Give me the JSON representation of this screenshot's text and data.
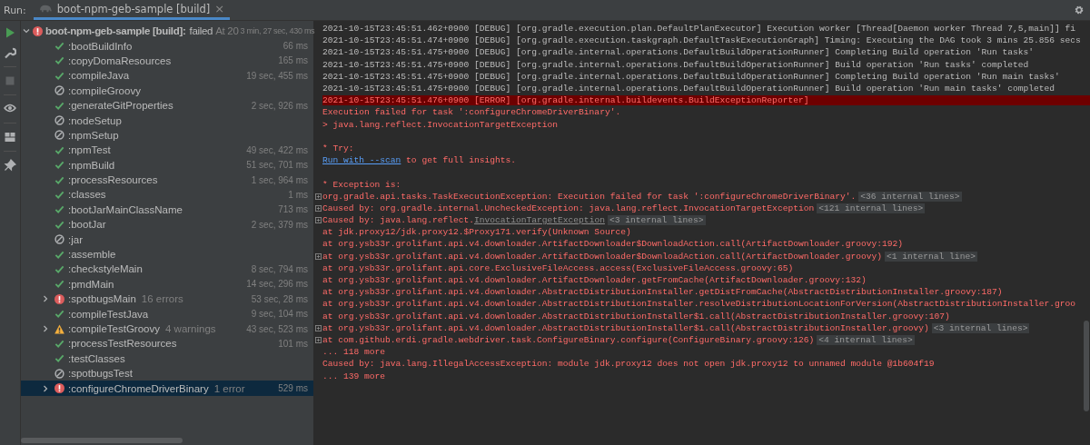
{
  "run_bar": {
    "label": "Run:",
    "tab": {
      "title": "boot-npm-geb-sample [build]",
      "close": "×",
      "selected": true
    }
  },
  "toolbar": [
    {
      "kind": "play"
    },
    {
      "kind": "wrench"
    },
    {
      "kind": "stop"
    },
    {
      "kind": "eye"
    },
    {
      "kind": "layout"
    },
    {
      "kind": "pin"
    }
  ],
  "tree": {
    "root": {
      "kind": "error",
      "name": "boot-npm-geb-sample [build]:",
      "state_text": "failed",
      "note": "At 20",
      "duration": "3 min, 27 sec, 430 ms",
      "expanded": true,
      "selected": false,
      "children": [
        {
          "kind": "success",
          "name": ":bootBuildInfo",
          "duration": "66 ms",
          "selected": false
        },
        {
          "kind": "success",
          "name": ":copyDomaResources",
          "duration": "165 ms",
          "selected": false
        },
        {
          "kind": "success",
          "name": ":compileJava",
          "duration": "19 sec, 455 ms",
          "selected": false
        },
        {
          "kind": "skipped",
          "name": ":compileGroovy",
          "selected": false
        },
        {
          "kind": "success",
          "name": ":generateGitProperties",
          "duration": "2 sec, 926 ms",
          "selected": false
        },
        {
          "kind": "skipped",
          "name": ":nodeSetup",
          "selected": false
        },
        {
          "kind": "skipped",
          "name": ":npmSetup",
          "selected": false
        },
        {
          "kind": "success",
          "name": ":npmTest",
          "duration": "49 sec, 422 ms",
          "selected": false
        },
        {
          "kind": "success",
          "name": ":npmBuild",
          "duration": "51 sec, 701 ms",
          "selected": false
        },
        {
          "kind": "success",
          "name": ":processResources",
          "duration": "1 sec, 964 ms",
          "selected": false
        },
        {
          "kind": "success",
          "name": ":classes",
          "duration": "1 ms",
          "selected": false
        },
        {
          "kind": "success",
          "name": ":bootJarMainClassName",
          "duration": "713 ms",
          "selected": false
        },
        {
          "kind": "success",
          "name": ":bootJar",
          "duration": "2 sec, 379 ms",
          "selected": false
        },
        {
          "kind": "skipped",
          "name": ":jar",
          "selected": false
        },
        {
          "kind": "success",
          "name": ":assemble",
          "selected": false
        },
        {
          "kind": "success",
          "name": ":checkstyleMain",
          "duration": "8 sec, 794 ms",
          "selected": false
        },
        {
          "kind": "success",
          "name": ":pmdMain",
          "duration": "14 sec, 296 ms",
          "selected": false
        },
        {
          "kind": "error",
          "name": ":spotbugsMain",
          "note": "16 errors",
          "duration": "53 sec, 28 ms",
          "expanded": false,
          "selected": false
        },
        {
          "kind": "success",
          "name": ":compileTestJava",
          "duration": "9 sec, 104 ms",
          "selected": false
        },
        {
          "kind": "warning",
          "name": ":compileTestGroovy",
          "note": "4 warnings",
          "duration": "43 sec, 523 ms",
          "expanded": false,
          "selected": false
        },
        {
          "kind": "success",
          "name": ":processTestResources",
          "duration": "101 ms",
          "selected": false
        },
        {
          "kind": "success",
          "name": ":testClasses",
          "selected": false
        },
        {
          "kind": "skipped",
          "name": ":spotbugsTest",
          "selected": false
        },
        {
          "kind": "error",
          "name": ":configureChromeDriverBinary",
          "note": "1 error",
          "duration": "529 ms",
          "expanded": false,
          "selected": true
        }
      ]
    }
  },
  "console": {
    "lines": [
      {
        "kind": "debug",
        "text": "2021-10-15T23:45:51.462+0900 [DEBUG] [org.gradle.execution.plan.DefaultPlanExecutor] Execution worker [Thread[Daemon worker Thread 7,5,main]] fi"
      },
      {
        "kind": "debug",
        "text": "2021-10-15T23:45:51.474+0900 [DEBUG] [org.gradle.execution.taskgraph.DefaultTaskExecutionGraph] Timing: Executing the DAG took 3 mins 25.856 secs"
      },
      {
        "kind": "debug",
        "text": "2021-10-15T23:45:51.475+0900 [DEBUG] [org.gradle.internal.operations.DefaultBuildOperationRunner] Completing Build operation 'Run tasks'"
      },
      {
        "kind": "debug",
        "text": "2021-10-15T23:45:51.475+0900 [DEBUG] [org.gradle.internal.operations.DefaultBuildOperationRunner] Build operation 'Run tasks' completed"
      },
      {
        "kind": "debug",
        "text": "2021-10-15T23:45:51.475+0900 [DEBUG] [org.gradle.internal.operations.DefaultBuildOperationRunner] Completing Build operation 'Run main tasks'"
      },
      {
        "kind": "debug",
        "text": "2021-10-15T23:45:51.475+0900 [DEBUG] [org.gradle.internal.operations.DefaultBuildOperationRunner] Build operation 'Run main tasks' completed"
      },
      {
        "kind": "error_header",
        "text": "2021-10-15T23:45:51.476+0900 [ERROR] [org.gradle.internal.buildevents.BuildExceptionReporter]"
      },
      {
        "kind": "error",
        "text": "Execution failed for task ':configureChromeDriverBinary'."
      },
      {
        "kind": "error",
        "text": "> java.lang.reflect.InvocationTargetException"
      },
      {
        "kind": "blank"
      },
      {
        "kind": "error",
        "text": "* Try:"
      },
      {
        "kind": "error",
        "link": {
          "kind": "hyperlink",
          "text": "Run with --scan"
        },
        "text_after": " to get full insights."
      },
      {
        "kind": "blank"
      },
      {
        "kind": "error",
        "text": "* Exception is:"
      },
      {
        "kind": "error",
        "collapsed": true,
        "text": "org.gradle.api.tasks.TaskExecutionException: Execution failed for task ':configureChromeDriverBinary'.",
        "internal": "<36 internal lines>"
      },
      {
        "kind": "error",
        "collapsed": true,
        "text": "Caused by: org.gradle.internal.UncheckedException: java.lang.reflect.InvocationTargetException",
        "internal": "<121 internal lines>"
      },
      {
        "kind": "error",
        "collapsed": true,
        "text": "Caused by: java.lang.reflect.",
        "link": {
          "kind": "class",
          "text": "InvocationTargetException"
        },
        "internal": "<3 internal lines>"
      },
      {
        "kind": "error",
        "text": "at jdk.proxy12/jdk.proxy12.$Proxy171.verify(Unknown Source)"
      },
      {
        "kind": "error",
        "text": "at org.ysb33r.grolifant.api.v4.downloader.ArtifactDownloader$DownloadAction.call(ArtifactDownloader.groovy:192)"
      },
      {
        "kind": "error",
        "collapsed": true,
        "text": "at org.ysb33r.grolifant.api.v4.downloader.ArtifactDownloader$DownloadAction.call(ArtifactDownloader.groovy)",
        "internal": "<1 internal line>"
      },
      {
        "kind": "error",
        "text": "at org.ysb33r.grolifant.api.core.ExclusiveFileAccess.access(ExclusiveFileAccess.groovy:65)"
      },
      {
        "kind": "error",
        "text": "at org.ysb33r.grolifant.api.v4.downloader.ArtifactDownloader.getFromCache(ArtifactDownloader.groovy:132)"
      },
      {
        "kind": "error",
        "text": "at org.ysb33r.grolifant.api.v4.downloader.AbstractDistributionInstaller.getDistFromCache(AbstractDistributionInstaller.groovy:187)"
      },
      {
        "kind": "error",
        "text": "at org.ysb33r.grolifant.api.v4.downloader.AbstractDistributionInstaller.resolveDistributionLocationForVersion(AbstractDistributionInstaller.groo"
      },
      {
        "kind": "error",
        "text": "at org.ysb33r.grolifant.api.v4.downloader.AbstractDistributionInstaller$1.call(AbstractDistributionInstaller.groovy:107)"
      },
      {
        "kind": "error",
        "collapsed": true,
        "text": "at org.ysb33r.grolifant.api.v4.downloader.AbstractDistributionInstaller$1.call(AbstractDistributionInstaller.groovy)",
        "internal": "<3 internal lines>"
      },
      {
        "kind": "error",
        "collapsed": true,
        "text": "at com.github.erdi.gradle.webdriver.task.ConfigureBinary.configure(ConfigureBinary.groovy:126)",
        "internal": "<4 internal lines>"
      },
      {
        "kind": "error",
        "text": "... 118 more"
      },
      {
        "kind": "error",
        "text": "Caused by: java.lang.IllegalAccessException: module jdk.proxy12 does not open jdk.proxy12 to unnamed module @1b604f19"
      },
      {
        "kind": "error",
        "text": "... 139 more"
      }
    ]
  }
}
